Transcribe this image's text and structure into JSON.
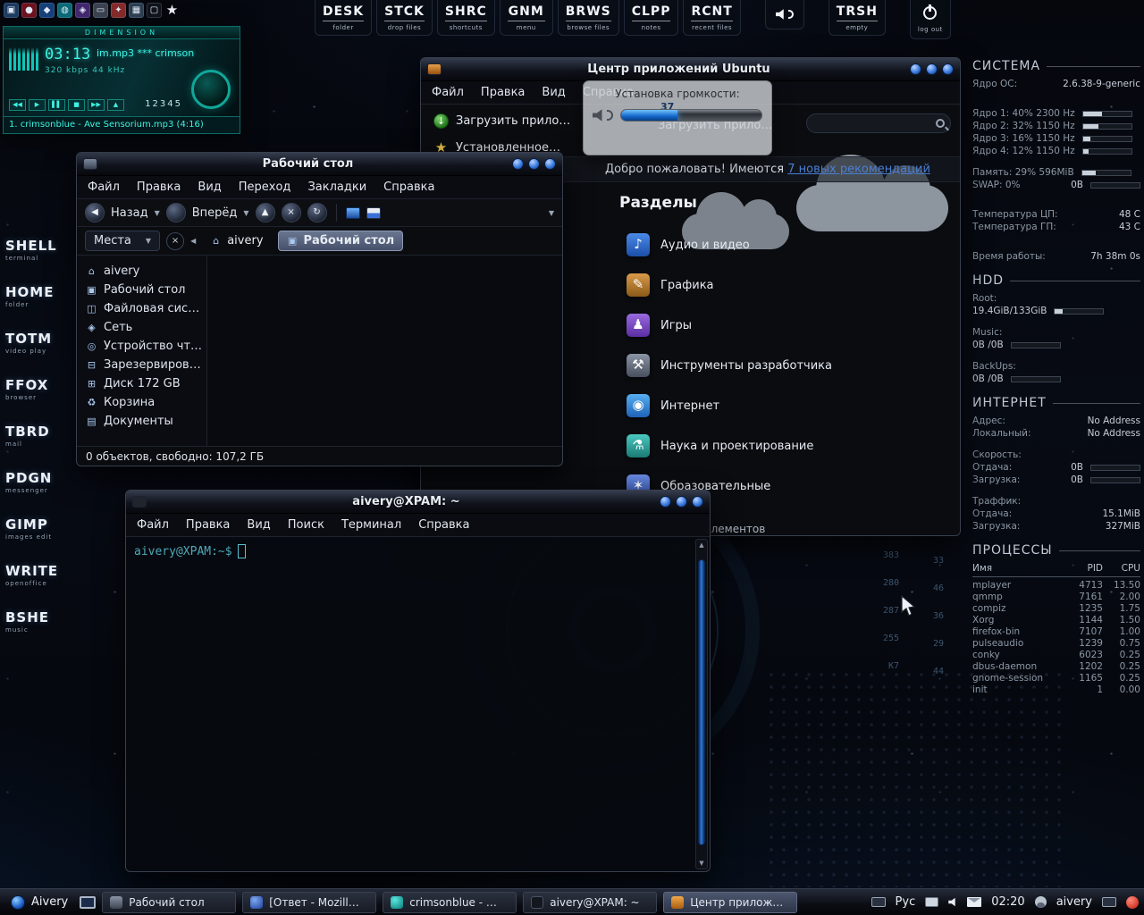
{
  "topIcons": [
    {
      "name": "window-app",
      "glyph": "▣"
    },
    {
      "name": "media-app",
      "glyph": "●"
    },
    {
      "name": "blue-app",
      "glyph": "◆"
    },
    {
      "name": "cyan-orb-app",
      "glyph": "◍"
    },
    {
      "name": "purple-app",
      "glyph": "◈"
    },
    {
      "name": "keyboard-app",
      "glyph": "▭"
    },
    {
      "name": "red-badge-app",
      "glyph": "✦"
    },
    {
      "name": "grid-app",
      "glyph": "▦"
    },
    {
      "name": "monitor-app",
      "glyph": "▢"
    },
    {
      "name": "favorites",
      "glyph": "★"
    }
  ],
  "dock": {
    "items": [
      {
        "label": "DESK",
        "sub": "folder"
      },
      {
        "label": "STCK",
        "sub": "drop files"
      },
      {
        "label": "SHRC",
        "sub": "shortcuts"
      },
      {
        "label": "GNM",
        "sub": "menu"
      },
      {
        "label": "BRWS",
        "sub": "browse files"
      },
      {
        "label": "CLPP",
        "sub": "notes"
      },
      {
        "label": "RCNT",
        "sub": "recent files"
      }
    ],
    "trash": {
      "label": "TRSH",
      "sub": "empty"
    },
    "logout_sub": "log out"
  },
  "player": {
    "brand": "DIMENSION",
    "time": "03:13",
    "track": "im.mp3 *** crimson",
    "bitrate": "320 kbps",
    "samplerate": "44 kHz",
    "eq_numbers": "12345",
    "controls": [
      "◀◀",
      "▶",
      "▌▌",
      "■",
      "▶▶",
      "▲"
    ],
    "playlist_entry": "1. crimsonblue - Ave Sensorium.mp3 (4:16)"
  },
  "launchers": [
    {
      "label": "SHELL",
      "sub": "terminal"
    },
    {
      "label": "HOME",
      "sub": "folder"
    },
    {
      "label": "TOTM",
      "sub": "video play"
    },
    {
      "label": "FFOX",
      "sub": "browser"
    },
    {
      "label": "TBRD",
      "sub": "mail"
    },
    {
      "label": "PDGN",
      "sub": "messenger"
    },
    {
      "label": "GIMP",
      "sub": "images edit"
    },
    {
      "label": "WRITE",
      "sub": "openoffice"
    },
    {
      "label": "BSHE",
      "sub": "music"
    }
  ],
  "fm": {
    "title": "Рабочий стол",
    "menus": [
      "Файл",
      "Правка",
      "Вид",
      "Переход",
      "Закладки",
      "Справка"
    ],
    "back": "Назад",
    "forward": "Вперёд",
    "places_label": "Места",
    "breadcrumbs": [
      {
        "label": "aivery",
        "icon": "⌂"
      },
      {
        "label": "Рабочий стол",
        "icon": "▣"
      }
    ],
    "places": [
      {
        "label": "aivery",
        "icon": "⌂"
      },
      {
        "label": "Рабочий стол",
        "icon": "▣"
      },
      {
        "label": "Файловая сис…",
        "icon": "◫"
      },
      {
        "label": "Сеть",
        "icon": "◈"
      },
      {
        "label": "Устройство чт…",
        "icon": "◎"
      },
      {
        "label": "Зарезервиров…",
        "icon": "⊟"
      },
      {
        "label": "Диск 172 GB",
        "icon": "⊞"
      },
      {
        "label": "Корзина",
        "icon": "♻"
      },
      {
        "label": "Документы",
        "icon": "▤"
      }
    ],
    "status": "0 объектов, свободно: 107,2 ГБ"
  },
  "usc": {
    "title": "Центр приложений Ubuntu",
    "menus": [
      "Файл",
      "Правка",
      "Вид",
      "Справка"
    ],
    "nav": [
      {
        "label": "Загрузить прило…",
        "icon": "↓"
      },
      {
        "label": "Установленное…",
        "icon": "★"
      }
    ],
    "breadcrumb": "Загрузить прило…",
    "welcome_prefix": "Добро пожаловать! Имеются ",
    "welcome_link": "7 новых рекомендаций",
    "sections_title": "Разделы",
    "categories": [
      {
        "label": "Аудио и видео",
        "icon": "♪"
      },
      {
        "label": "Графика",
        "icon": "✎"
      },
      {
        "label": "Игры",
        "icon": "♟"
      },
      {
        "label": "Инструменты разработчика",
        "icon": "⚒"
      },
      {
        "label": "Интернет",
        "icon": "◉"
      },
      {
        "label": "Наука и проектирование",
        "icon": "⚗"
      },
      {
        "label": "Образовательные",
        "icon": "✶"
      }
    ],
    "status_partial": "элементов"
  },
  "volume": {
    "title": "Установка громкости:",
    "value": "37",
    "percent": 40
  },
  "terminal": {
    "title": "aivery@XPAM: ~",
    "menus": [
      "Файл",
      "Правка",
      "Вид",
      "Поиск",
      "Терминал",
      "Справка"
    ],
    "prompt": "aivery@XPAM:~$"
  },
  "conky": {
    "system": {
      "title": "СИСТЕМА",
      "kernel_label": "Ядро ОС:",
      "kernel": "2.6.38-9-generic",
      "cores": [
        {
          "l": "Ядро 1: 40% 2300 Hz",
          "pct": 40
        },
        {
          "l": "Ядро 2: 32% 1150 Hz",
          "pct": 32
        },
        {
          "l": "Ядро 3: 16% 1150 Hz",
          "pct": 16
        },
        {
          "l": "Ядро 4: 12% 1150 Hz",
          "pct": 12
        }
      ],
      "mem": {
        "l": "Память: 29%  596MiB",
        "pct": 29
      },
      "swap": {
        "l": "SWAP: 0%",
        "v": "0B",
        "pct": 0
      },
      "temps": [
        {
          "l": "Температура ЦП:",
          "v": "48 C"
        },
        {
          "l": "Температура ГП:",
          "v": "43 C"
        }
      ],
      "uptime": {
        "l": "Время работы:",
        "v": "7h 38m 0s"
      }
    },
    "hdd": {
      "title": "HDD",
      "drives": [
        {
          "l": "Root:",
          "v": "19.4GiB/133GiB",
          "pct": 15
        },
        {
          "l": "Music:",
          "v": "0B /0B",
          "pct": 0
        },
        {
          "l": "BackUps:",
          "v": "0B /0B",
          "pct": 0
        }
      ]
    },
    "net": {
      "title": "ИНТЕРНЕТ",
      "rows1": [
        {
          "l": "Адрес:",
          "v": "No Address"
        },
        {
          "l": "Локальный:",
          "v": "No Address"
        }
      ],
      "speed_label": "Скорость:",
      "speed": [
        {
          "l": "Отдача:",
          "v": "0B",
          "pct": 0
        },
        {
          "l": "Загрузка:",
          "v": "0B",
          "pct": 0
        }
      ],
      "traffic_label": "Траффик:",
      "traffic": [
        {
          "l": "Отдача:",
          "v": "15.1MiB"
        },
        {
          "l": "Загрузка:",
          "v": "327MiB"
        }
      ]
    },
    "proc": {
      "title": "ПРОЦЕССЫ",
      "headers": {
        "name": "Имя",
        "pid": "PID",
        "cpu": "CPU"
      },
      "rows": [
        {
          "n": "mplayer",
          "pid": "4713",
          "cpu": "13.50"
        },
        {
          "n": "qmmp",
          "pid": "7161",
          "cpu": "2.00"
        },
        {
          "n": "compiz",
          "pid": "1235",
          "cpu": "1.75"
        },
        {
          "n": "Xorg",
          "pid": "1144",
          "cpu": "1.50"
        },
        {
          "n": "firefox-bin",
          "pid": "7107",
          "cpu": "1.00"
        },
        {
          "n": "pulseaudio",
          "pid": "1239",
          "cpu": "0.75"
        },
        {
          "n": "conky",
          "pid": "6023",
          "cpu": "0.25"
        },
        {
          "n": "dbus-daemon",
          "pid": "1202",
          "cpu": "0.25"
        },
        {
          "n": "gnome-session",
          "pid": "1165",
          "cpu": "0.25"
        },
        {
          "n": "init",
          "pid": "1",
          "cpu": "0.00"
        }
      ]
    }
  },
  "taskbar": {
    "menu_label": "Aivery",
    "tasks": [
      "Рабочий стол",
      "[Ответ - Mozill…",
      "crimsonblue - …",
      "aivery@XPAM: ~",
      "Центр прилож…"
    ],
    "tray": {
      "lang": "Рус",
      "clock": "02:20",
      "user": "aivery"
    }
  },
  "wallpaper": {
    "hud_left": [
      "383",
      "280",
      "287",
      "255",
      "K7"
    ],
    "hud_right": [
      "33",
      "46",
      "36",
      "29",
      "44"
    ]
  }
}
